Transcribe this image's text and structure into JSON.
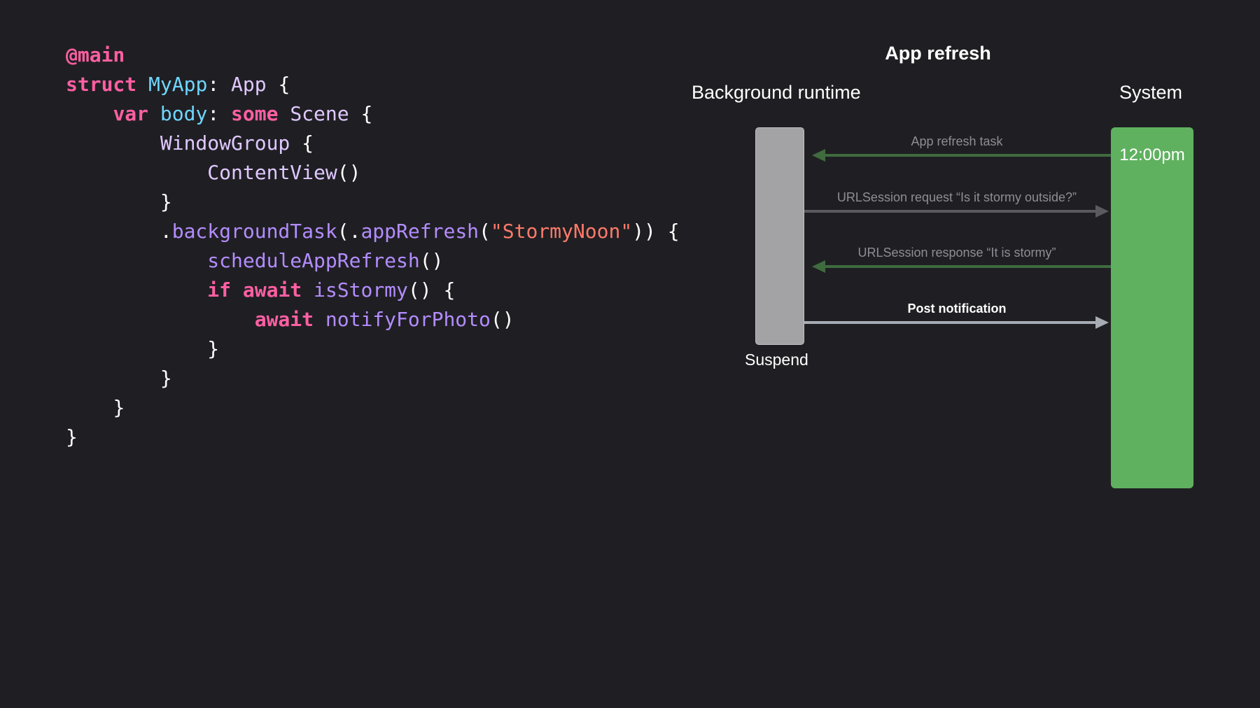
{
  "code": {
    "line1": {
      "a": "@main"
    },
    "line2": {
      "a": "struct",
      "b": "MyApp",
      "c": ":",
      "d": "App",
      "e": "{"
    },
    "line3": {
      "a": "var",
      "b": "body",
      "c": ":",
      "d": "some",
      "e": "Scene",
      "f": "{"
    },
    "line4": {
      "a": "WindowGroup",
      "b": "{"
    },
    "line5": {
      "a": "ContentView",
      "b": "()"
    },
    "line6": {
      "a": "}"
    },
    "line7": {
      "a": ".",
      "b": "backgroundTask",
      "c": "(.",
      "d": "appRefresh",
      "e": "(",
      "f": "\"StormyNoon\"",
      "g": "))",
      "h": "{"
    },
    "line8": {
      "a": "scheduleAppRefresh",
      "b": "()"
    },
    "line9": {
      "a": "if",
      "b": "await",
      "c": "isStormy",
      "d": "()",
      "e": "{"
    },
    "line10": {
      "a": "await",
      "b": "notifyForPhoto",
      "c": "()"
    },
    "line11": {
      "a": "}"
    },
    "line12": {
      "a": "}"
    },
    "line13": {
      "a": "}"
    },
    "line14": {
      "a": "}"
    }
  },
  "diagram": {
    "title": "App refresh",
    "left_column": "Background runtime",
    "right_column": "System",
    "system_time": "12:00pm",
    "suspend_label": "Suspend",
    "messages": [
      {
        "label": "App refresh task",
        "direction": "to-runtime",
        "color": "#3f6b3f"
      },
      {
        "label": "URLSession request “Is it stormy outside?”",
        "direction": "to-system",
        "color": "#5a5a5f"
      },
      {
        "label": "URLSession response “It is stormy”",
        "direction": "to-runtime",
        "color": "#3f6b3f"
      },
      {
        "label": "Post notification",
        "direction": "to-system",
        "color": "#a7acb4"
      }
    ]
  },
  "colors": {
    "background": "#1f1f23",
    "runtime_bar": "#a3a3a6",
    "system_bar": "#5fb15f"
  }
}
